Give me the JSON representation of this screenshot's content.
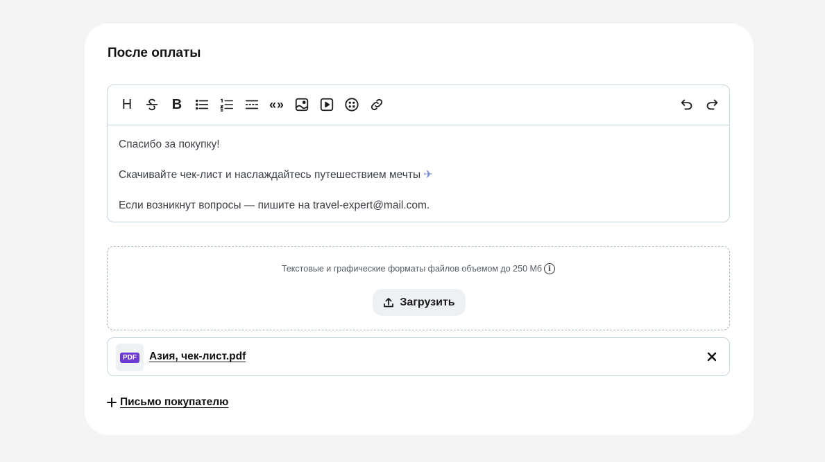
{
  "section": {
    "title": "После оплаты"
  },
  "toolbar": {
    "heading_glyph": "H",
    "bold_glyph": "B",
    "quote_glyph": "«»",
    "left_buttons": [
      "heading-icon",
      "strikethrough-icon",
      "bold-icon",
      "bullet-list-icon",
      "numbered-list-icon",
      "divider-icon",
      "quote-icon",
      "image-icon",
      "video-icon",
      "emoji-icon",
      "link-icon"
    ],
    "right_buttons": [
      "undo-icon",
      "redo-icon"
    ]
  },
  "editor": {
    "line1": "Спасибо за покупку!",
    "line2": "Скачивайте чек-лист и наслаждайтесь путешествием мечты",
    "line2_emoji": "✈",
    "line3": "Если возникнут вопросы — пишите на travel-expert@mail.com."
  },
  "dropzone": {
    "hint": "Текстовые и графические форматы файлов объемом до 250 Мб",
    "upload_label": "Загрузить"
  },
  "file": {
    "badge": "PDF",
    "name": "Азия, чек-лист.pdf"
  },
  "add_letter": {
    "label": "Письмо покупателю"
  },
  "colors": {
    "background": "#f4f4f4",
    "card": "#ffffff",
    "border": "#c5d5de",
    "pdf_badge": "#6d3bd1",
    "button_bg": "#eef1f4"
  }
}
